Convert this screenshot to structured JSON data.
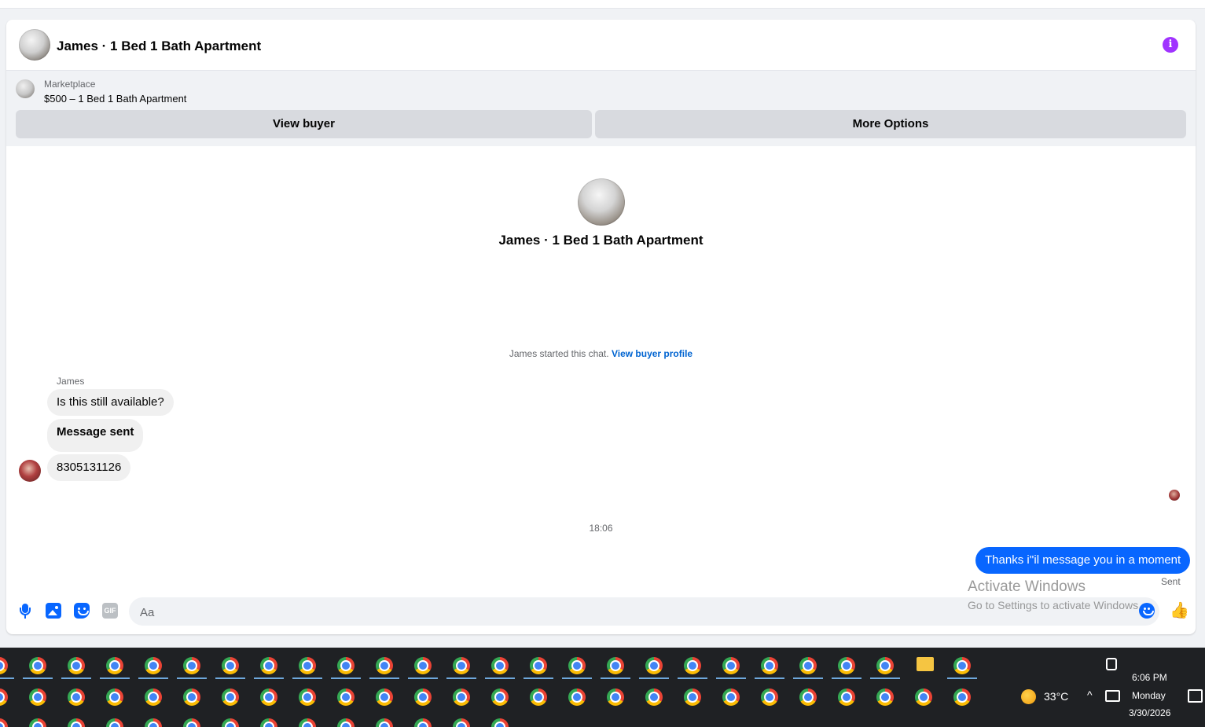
{
  "header": {
    "title": "James · 1 Bed 1 Bath Apartment"
  },
  "marketplace": {
    "label": "Marketplace",
    "item": "$500 – 1 Bed 1 Bath Apartment",
    "view_buyer_label": "View buyer",
    "more_options_label": "More Options"
  },
  "chat": {
    "center_title": "James · 1 Bed 1 Bath Apartment",
    "started_text": "James started this chat.",
    "view_profile_link": "View buyer profile",
    "sender_name": "James",
    "messages_in": [
      "Is this still available?",
      "Message sent",
      "8305131126"
    ],
    "timestamp": "18:06",
    "message_out": "Thanks i''il message you in a moment",
    "status": "Sent"
  },
  "composer": {
    "placeholder": "Aa",
    "gif_label": "GIF"
  },
  "watermark": {
    "line1": "Activate Windows",
    "line2": "Go to Settings to activate Windows."
  },
  "taskbar": {
    "weather": "33°C",
    "time": "6:06 PM",
    "day": "Monday",
    "date": "3/30/2026"
  },
  "colors": {
    "accent": "#0866ff",
    "info_icon": "#a033ff",
    "link": "#0064d1",
    "taskbar": "#1f2124"
  }
}
